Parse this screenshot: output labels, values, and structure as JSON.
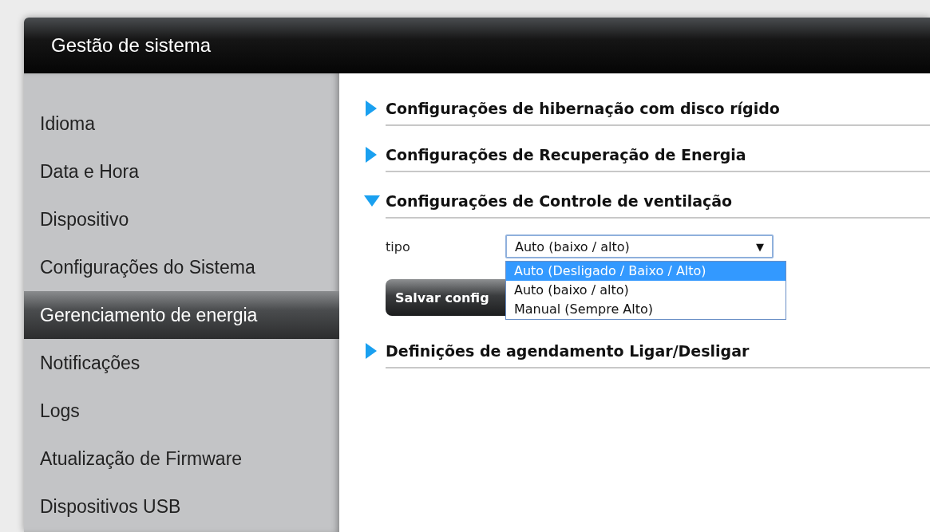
{
  "window": {
    "title": "Gestão de sistema"
  },
  "sidebar": {
    "items": [
      {
        "label": "Idioma",
        "selected": false
      },
      {
        "label": "Data e Hora",
        "selected": false
      },
      {
        "label": "Dispositivo",
        "selected": false
      },
      {
        "label": "Configurações do Sistema",
        "selected": false
      },
      {
        "label": "Gerenciamento de energia",
        "selected": true
      },
      {
        "label": "Notificações",
        "selected": false
      },
      {
        "label": "Logs",
        "selected": false
      },
      {
        "label": "Atualização de Firmware",
        "selected": false
      },
      {
        "label": "Dispositivos USB",
        "selected": false
      }
    ]
  },
  "sections": [
    {
      "title": "Configurações de hibernação com disco rígido",
      "expanded": false
    },
    {
      "title": "Configurações de Recuperação de Energia",
      "expanded": false
    },
    {
      "title": "Configurações de Controle de ventilação",
      "expanded": true,
      "field": {
        "label": "tipo",
        "value": "Auto (baixo / alto)",
        "caret": "▼",
        "options": [
          {
            "label": "Auto (Desligado / Baixo / Alto)",
            "highlighted": true
          },
          {
            "label": "Auto (baixo / alto)",
            "highlighted": false
          },
          {
            "label": "Manual (Sempre Alto)",
            "highlighted": false
          }
        ]
      },
      "button": "Salvar config"
    },
    {
      "title": "Definições de agendamento Ligar/Desligar",
      "expanded": false
    }
  ]
}
